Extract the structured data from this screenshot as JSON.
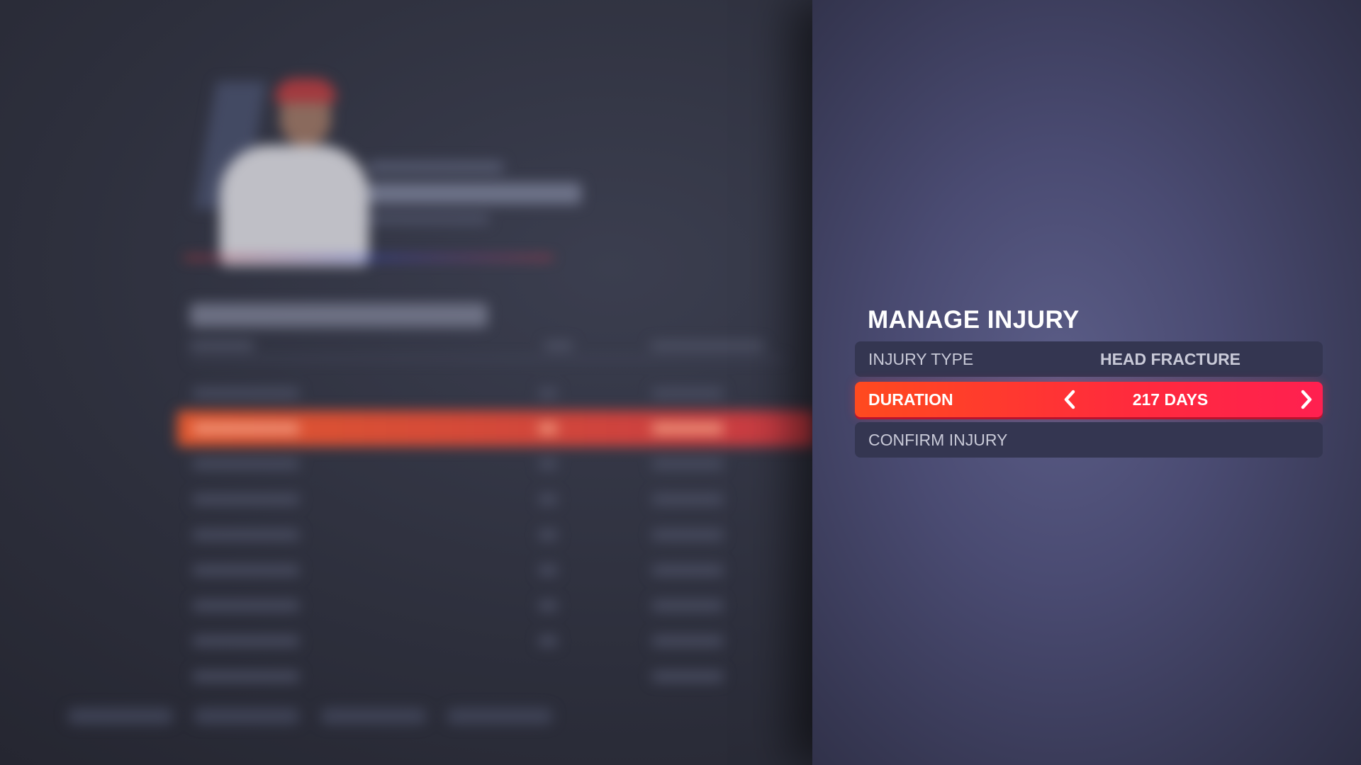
{
  "modal": {
    "title": "MANAGE INJURY",
    "rows": [
      {
        "label": "INJURY TYPE",
        "value": "HEAD FRACTURE",
        "selected": false
      },
      {
        "label": "DURATION",
        "value": "217 DAYS",
        "selected": true
      },
      {
        "label": "CONFIRM INJURY",
        "value": "",
        "selected": false
      }
    ]
  },
  "colors": {
    "selected_start": "#ff4a1f",
    "selected_end": "#ff2050",
    "row_bg": "#343651",
    "panel_center": "#5a5c86"
  },
  "icons": {
    "left": "chevron-left-icon",
    "right": "chevron-right-icon"
  }
}
